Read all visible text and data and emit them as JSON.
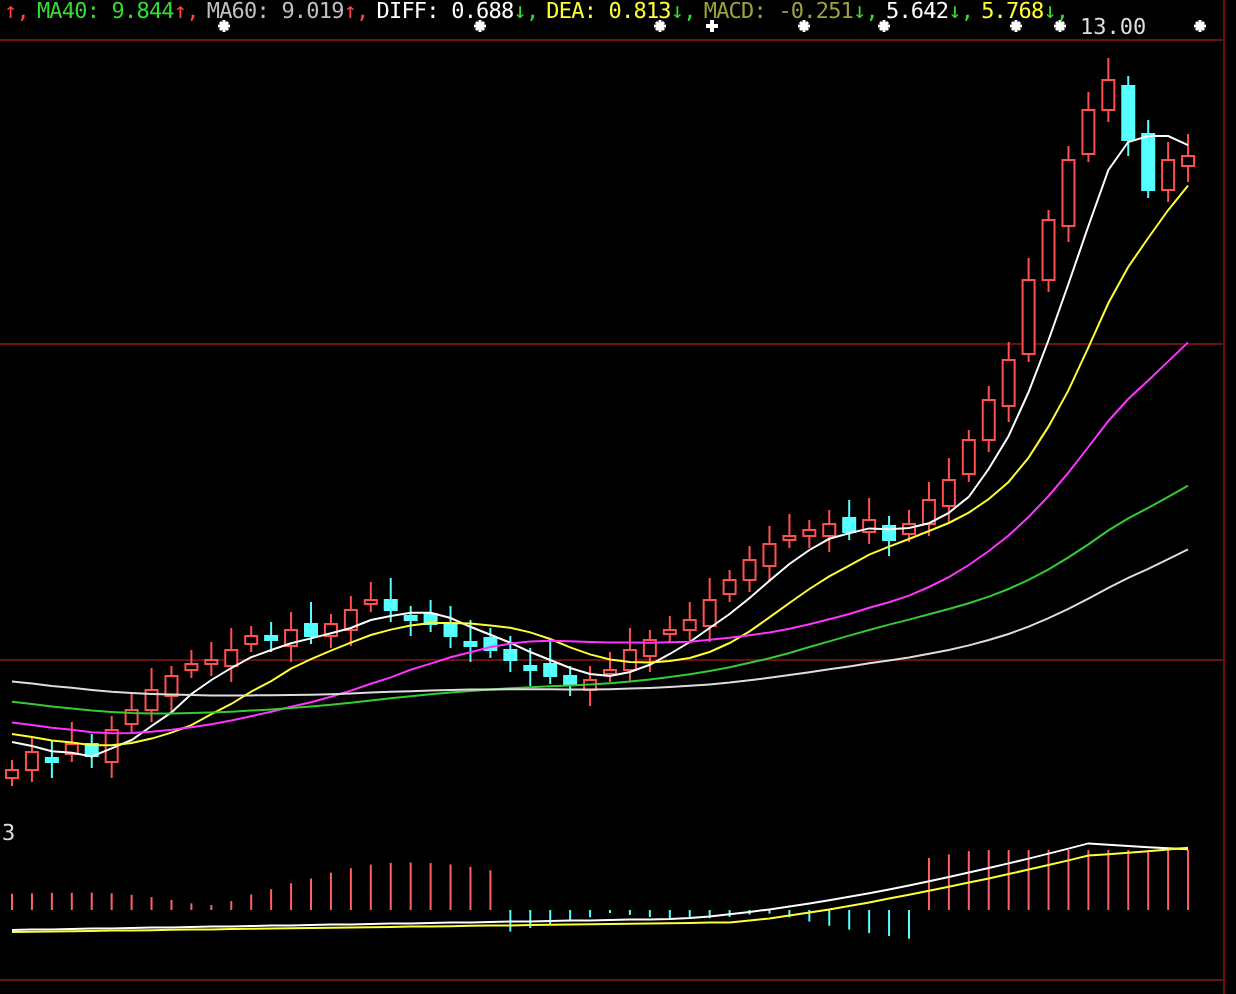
{
  "legend": [
    {
      "kind": "up",
      "arrow": "↑,"
    },
    {
      "label": "MA40:",
      "value": "9.844",
      "color": "#33dd33",
      "kind": "up",
      "arrow": "↑,"
    },
    {
      "label": "MA60:",
      "value": "9.019",
      "color": "#c0c0c0",
      "kind": "up",
      "arrow": "↑,"
    },
    {
      "label": "DIFF:",
      "value": "0.688",
      "color": "#ffffff",
      "kind": "down",
      "arrow": "↓,"
    },
    {
      "label": "DEA:",
      "value": "0.813",
      "color": "#ffff33",
      "kind": "down",
      "arrow": "↓,"
    },
    {
      "label": "MACD:",
      "value": "-0.251",
      "color": "#a0a040",
      "kind": "down",
      "arrow": "↓,"
    },
    {
      "value": "5.642",
      "color": "#ffffff",
      "kind": "down",
      "arrow": "↓,"
    },
    {
      "value": "5.768",
      "color": "#ffff33",
      "kind": "down",
      "arrow": "↓,"
    }
  ],
  "price_label": "13.00",
  "macd_pane": {
    "axis_label": "3"
  }
}
